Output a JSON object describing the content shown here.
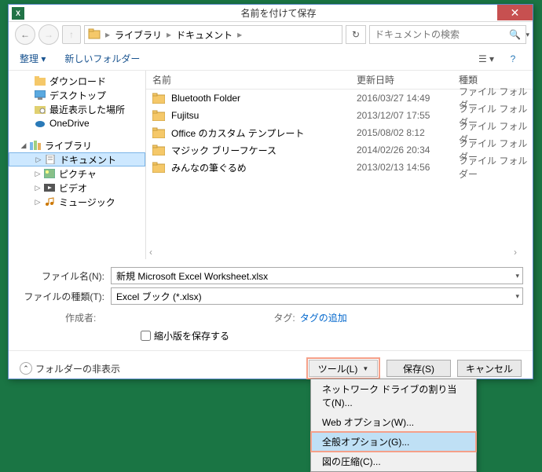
{
  "title": "名前を付けて保存",
  "app_icon_text": "X",
  "path": {
    "seg1": "ライブラリ",
    "seg2": "ドキュメント"
  },
  "search_placeholder": "ドキュメントの検索",
  "toolbar": {
    "organize": "整理",
    "new_folder": "新しいフォルダー"
  },
  "sidebar": {
    "downloads": "ダウンロード",
    "desktop": "デスクトップ",
    "recent": "最近表示した場所",
    "onedrive": "OneDrive",
    "libraries": "ライブラリ",
    "documents": "ドキュメント",
    "pictures": "ピクチャ",
    "videos": "ビデオ",
    "music": "ミュージック"
  },
  "columns": {
    "name": "名前",
    "date": "更新日時",
    "type": "種類"
  },
  "files": [
    {
      "name": "Bluetooth Folder",
      "date": "2016/03/27 14:49",
      "type": "ファイル フォルダー"
    },
    {
      "name": "Fujitsu",
      "date": "2013/12/07 17:55",
      "type": "ファイル フォルダー"
    },
    {
      "name": "Office のカスタム テンプレート",
      "date": "2015/08/02 8:12",
      "type": "ファイル フォルダー"
    },
    {
      "name": "マジック ブリーフケース",
      "date": "2014/02/26 20:34",
      "type": "ファイル フォルダー"
    },
    {
      "name": "みんなの筆ぐるめ",
      "date": "2013/02/13 14:56",
      "type": "ファイル フォルダー"
    }
  ],
  "form": {
    "filename_label": "ファイル名(N):",
    "filename_value": "新規 Microsoft Excel Worksheet.xlsx",
    "filetype_label": "ファイルの種類(T):",
    "filetype_value": "Excel ブック (*.xlsx)",
    "author_label": "作成者:",
    "author_value": "",
    "tag_label": "タグ:",
    "tag_value": "タグの追加",
    "thumb_label": "縮小版を保存する"
  },
  "hide_folders": "フォルダーの非表示",
  "buttons": {
    "tools": "ツール(L)",
    "save": "保存(S)",
    "cancel": "キャンセル"
  },
  "dropdown": {
    "network": "ネットワーク ドライブの割り当て(N)...",
    "web": "Web オプション(W)...",
    "general": "全般オプション(G)...",
    "compress": "図の圧縮(C)..."
  }
}
